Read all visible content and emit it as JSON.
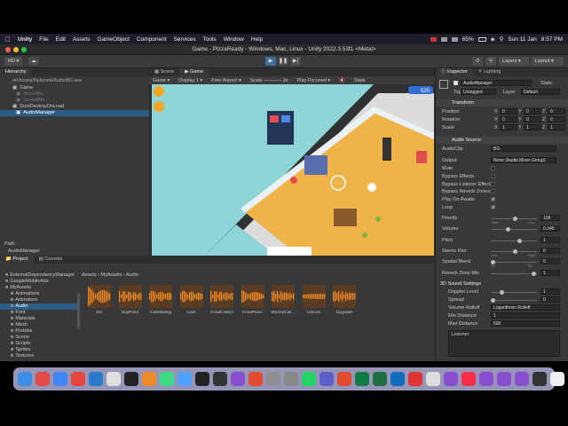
{
  "menubar": {
    "app": "Unity",
    "items": [
      "File",
      "Edit",
      "Assets",
      "GameObject",
      "Component",
      "Services",
      "Tools",
      "Window",
      "Help"
    ],
    "battery": "65%",
    "date": "Sun 11 Jan",
    "time": "8:57 PM"
  },
  "window_title": "Game - PizzaReady - Windows, Mac, Linux - Unity 2022.3.53f1 <Metal>",
  "toolbar": {
    "account": "RD",
    "layers": "Layers",
    "layout": "Layout"
  },
  "hierarchy": {
    "tab": "Hierarchy",
    "prefab_path": "ref:Assets/MyAssets/Audio/BG.wav",
    "items": [
      {
        "label": "Game",
        "state": "normal"
      },
      {
        "label": "MusicBtn",
        "state": "dim"
      },
      {
        "label": "SoundBtn",
        "state": "dim"
      },
      {
        "label": "DontDestroyOnLoad",
        "state": "normal"
      },
      {
        "label": "AudioManager",
        "state": "selected"
      }
    ],
    "path_label": "Path:",
    "path_value": "AudioManager"
  },
  "scene_tabs": [
    "Scene",
    "Game"
  ],
  "gamebar": {
    "mode": "Game",
    "display": "Display 1",
    "aspect": "Free Aspect",
    "scale_label": "Scale",
    "scale_value": "2x",
    "play_focused": "Play Focused",
    "stats": "Stats"
  },
  "game": {
    "coins": "520"
  },
  "inspector": {
    "tabs": [
      "Inspector",
      "Lighting"
    ],
    "object_name": "AudioManager",
    "static": "Static",
    "tag_label": "Tag",
    "tag": "Untagged",
    "layer_label": "Layer",
    "layer": "Default",
    "transform": {
      "title": "Transform",
      "rows": [
        {
          "label": "Position",
          "x": "0",
          "y": "0",
          "z": "0"
        },
        {
          "label": "Rotation",
          "x": "0",
          "y": "0",
          "z": "0"
        },
        {
          "label": "Scale",
          "x": "1",
          "y": "1",
          "z": "1"
        }
      ]
    },
    "audio": {
      "title": "Audio Source",
      "clip_label": "AudioClip",
      "clip": "BG",
      "output_label": "Output",
      "output": "None (Audio Mixer Group)",
      "toggles": [
        {
          "label": "Mute",
          "checked": false
        },
        {
          "label": "Bypass Effects",
          "checked": false
        },
        {
          "label": "Bypass Listener Effects",
          "checked": false
        },
        {
          "label": "Bypass Reverb Zones",
          "checked": false
        },
        {
          "label": "Play On Awake",
          "checked": true
        },
        {
          "label": "Loop",
          "checked": true
        }
      ],
      "sliders": [
        {
          "label": "Priority",
          "value": "128",
          "pos": 0.5,
          "low": "High",
          "high": "Low"
        },
        {
          "label": "Volume",
          "value": "0.345",
          "pos": 0.345
        },
        {
          "label": "Pitch",
          "value": "1",
          "pos": 0.6
        },
        {
          "label": "Stereo Pan",
          "value": "0",
          "pos": 0.5,
          "low": "Left",
          "high": "Right"
        },
        {
          "label": "Spatial Blend",
          "value": "0",
          "pos": 0.0,
          "low": "2D",
          "high": "3D"
        },
        {
          "label": "Reverb Zone Mix",
          "value": "1",
          "pos": 0.91
        }
      ],
      "sound3d": {
        "title": "3D Sound Settings",
        "doppler_label": "Doppler Level",
        "doppler": "1",
        "spread_label": "Spread",
        "spread": "0",
        "rolloff_label": "Volume Rolloff",
        "rolloff": "Logarithmic Rolloff",
        "min_label": "Min Distance",
        "min": "1",
        "max_label": "Max Distance",
        "max": "500",
        "listener": "Listener"
      }
    }
  },
  "project": {
    "tabs": [
      "Project",
      "Console"
    ],
    "breadcrumb": [
      "Assets",
      "MyAssets",
      "Audio"
    ],
    "tree": [
      {
        "label": "ExternalDependencyManager",
        "indent": 1
      },
      {
        "label": "GoogleMobileAds",
        "indent": 1
      },
      {
        "label": "MyAssets",
        "indent": 1
      },
      {
        "label": "Animations",
        "indent": 2
      },
      {
        "label": "Animators",
        "indent": 2
      },
      {
        "label": "Audio",
        "indent": 2,
        "selected": true
      },
      {
        "label": "Font",
        "indent": 2
      },
      {
        "label": "Materials",
        "indent": 2
      },
      {
        "label": "Mesh",
        "indent": 2
      },
      {
        "label": "Prefabs",
        "indent": 2
      },
      {
        "label": "Scene",
        "indent": 2
      },
      {
        "label": "Scripts",
        "indent": 2
      },
      {
        "label": "Sprites",
        "indent": 2
      },
      {
        "label": "Textures",
        "indent": 2
      }
    ],
    "assets": [
      "BG",
      "BuyPoint",
      "CashBilling",
      "Click",
      "FoodCollect",
      "FoodPlace",
      "MoneyColl...",
      "Unlock",
      "Upgrade"
    ]
  },
  "dock": [
    {
      "name": "finder",
      "color": "#3a8ee6"
    },
    {
      "name": "launchpad",
      "color": "#e34b4b"
    },
    {
      "name": "chrome",
      "color": "#4285f4"
    },
    {
      "name": "anydesk",
      "color": "#e8453c"
    },
    {
      "name": "vscode",
      "color": "#2a7acc"
    },
    {
      "name": "chrome-app",
      "color": "#e0e0e0"
    },
    {
      "name": "terminal",
      "color": "#222"
    },
    {
      "name": "vlc",
      "color": "#f08a24"
    },
    {
      "name": "android",
      "color": "#3ddc84"
    },
    {
      "name": "files",
      "color": "#4da3ff"
    },
    {
      "name": "unity-hub",
      "color": "#222"
    },
    {
      "name": "unity",
      "color": "#333"
    },
    {
      "name": "visual-studio",
      "color": "#8a4fd0"
    },
    {
      "name": "git",
      "color": "#e24c2c"
    },
    {
      "name": "settings",
      "color": "#8e8e93"
    },
    {
      "name": "mp3",
      "color": "#888"
    },
    {
      "name": "whatsapp",
      "color": "#25d366"
    },
    {
      "name": "teams",
      "color": "#5b5fc7"
    },
    {
      "name": "mail",
      "color": "#e24c2c"
    },
    {
      "name": "publisher",
      "color": "#107c41"
    },
    {
      "name": "excel",
      "color": "#1d6f42"
    },
    {
      "name": "outlook",
      "color": "#0f6cbd"
    },
    {
      "name": "pdf",
      "color": "#d33"
    },
    {
      "name": "photos",
      "color": "#ddd"
    },
    {
      "name": "vs2",
      "color": "#8a4fd0"
    },
    {
      "name": "music",
      "color": "#fa2d48"
    },
    {
      "name": "vs3",
      "color": "#8a4fd0"
    },
    {
      "name": "vs4",
      "color": "#8a4fd0"
    },
    {
      "name": "vs5",
      "color": "#8a4fd0"
    },
    {
      "name": "unity2",
      "color": "#333"
    },
    {
      "name": "preview",
      "color": "#eee"
    },
    {
      "name": "trash",
      "color": "#ccc"
    }
  ]
}
